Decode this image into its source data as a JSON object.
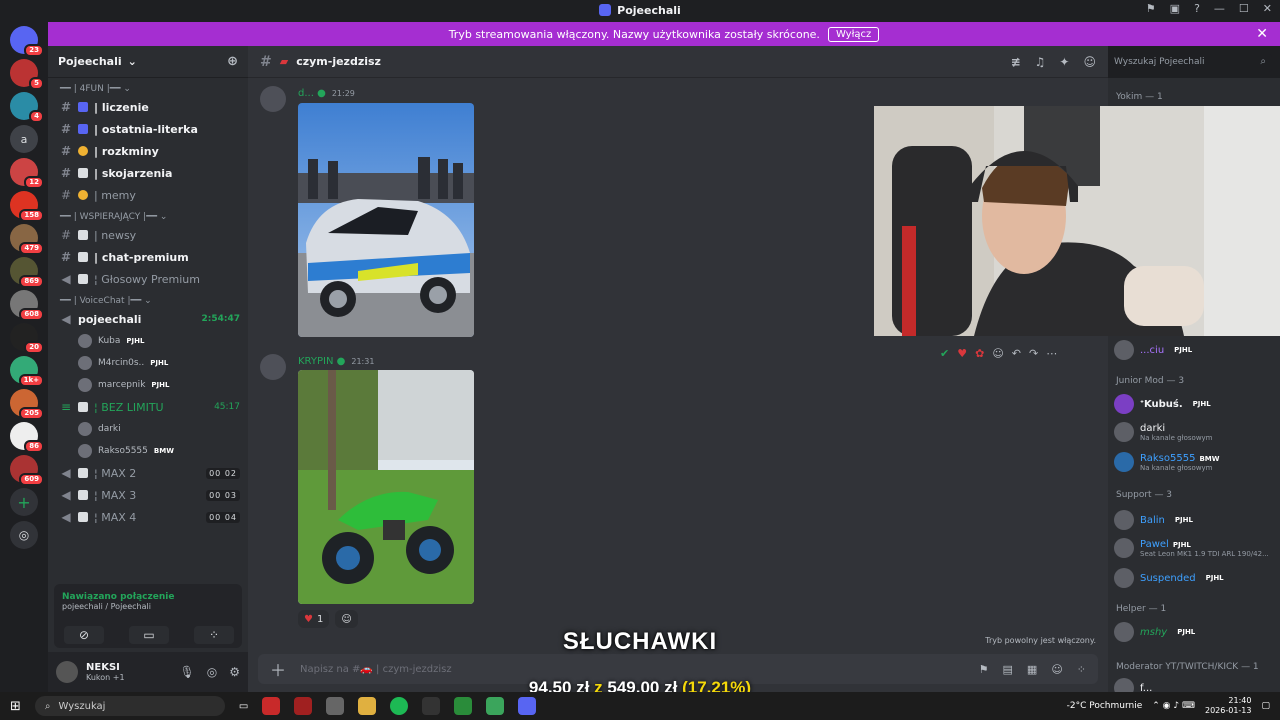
{
  "window": {
    "title": "Pojeechali"
  },
  "stream_bar": {
    "message": "Tryb streamowania włączony. Nazwy użytkownika zostały skrócone.",
    "button": "Wyłącz"
  },
  "server_rail": {
    "badges": [
      "23",
      "5",
      "4",
      "12",
      "158",
      "479",
      "869",
      "608",
      "20",
      "1k+",
      "205",
      "86",
      "609"
    ],
    "letter_icon": "a"
  },
  "guild": {
    "name": "Pojeechali"
  },
  "sidebar": {
    "cat_fun": "4FUN",
    "channels_fun": [
      {
        "name": "| liczenie",
        "unread": true
      },
      {
        "name": "| ostatnia-literka",
        "unread": true
      },
      {
        "name": "| rozkminy",
        "unread": true
      },
      {
        "name": "| skojarzenia",
        "unread": true
      },
      {
        "name": "| memy",
        "unread": false
      }
    ],
    "cat_support": "WSPIERAJĄCY",
    "channels_support": [
      {
        "name": "| newsy"
      },
      {
        "name": "| chat-premium"
      },
      {
        "name": "¦ Głosowy Premium"
      }
    ],
    "cat_voice": "VoiceChat",
    "voice_main": {
      "name": "pojeechali",
      "time": "2:54:47"
    },
    "voice_users_main": [
      {
        "name": "Kuba",
        "tag": "PJHL"
      },
      {
        "name": "M4rcin0s..",
        "tag": "PJHL"
      },
      {
        "name": "marcepnik",
        "tag": "PJHL"
      }
    ],
    "voice_limit": {
      "name": "¦ BEZ LIMITU",
      "time": "45:17"
    },
    "voice_users_limit": [
      {
        "name": "darki",
        "tag": ""
      },
      {
        "name": "Rakso5555",
        "tag": "BMW"
      }
    ],
    "voice_max": [
      {
        "name": "¦ MAX 2",
        "count": "00 02"
      },
      {
        "name": "¦ MAX 3",
        "count": "00 03"
      },
      {
        "name": "¦ MAX 4",
        "count": "00 04"
      }
    ]
  },
  "voice_panel": {
    "status": "Nawiązano połączenie",
    "location": "pojeechali / Pojeechali"
  },
  "user_panel": {
    "name": "NEKSI",
    "status": "Kukon +1"
  },
  "chat": {
    "channel": "czym-jezdzisz",
    "messages": [
      {
        "author": "d...",
        "time": "21:29"
      },
      {
        "author": "KRYPIN",
        "time": "21:31"
      }
    ],
    "reaction_count": "1",
    "composer_placeholder": "Napisz na #🚗 | czym-jezdzisz",
    "slowmode": "Tryb powolny jest włączony."
  },
  "search": {
    "placeholder": "Wyszukaj Pojeechali"
  },
  "members": {
    "g1": "Yokim — 1",
    "m_top": {
      "name": "...ciu",
      "tag": "PJHL"
    },
    "g2": "Junior Mod — 3",
    "junior": [
      {
        "name": "ᐩKubuś.",
        "tag": "PJHL",
        "sub": ""
      },
      {
        "name": "darki",
        "tag": "",
        "sub": "Na kanale głosowym"
      },
      {
        "name": "Rakso5555",
        "tag": "BMW",
        "sub": "Na kanale głosowym"
      }
    ],
    "g3": "Support — 3",
    "support": [
      {
        "name": "Balin",
        "tag": "PJHL",
        "sub": ""
      },
      {
        "name": "Pawel",
        "tag": "PJHL",
        "sub": "Seat Leon MK1 1.9 TDI ARL 190/42..."
      },
      {
        "name": "Suspended",
        "tag": "PJHL",
        "sub": ""
      }
    ],
    "g4": "Helper — 1",
    "helper": {
      "name": "mshy",
      "tag": "PJHL"
    },
    "g5": "Moderator YT/TWITCH/KICK — 1",
    "mod": {
      "name": "f..."
    }
  },
  "overlay": {
    "word": "SŁUCHAWKI",
    "amount": "94,50 zł",
    "of": "z",
    "goal": "549,00 zł",
    "percent": "(17.21%)"
  },
  "taskbar": {
    "search": "Wyszukaj",
    "weather": "-2°C Pochmurnie",
    "time": "21:40",
    "date": "2026-01-13"
  }
}
